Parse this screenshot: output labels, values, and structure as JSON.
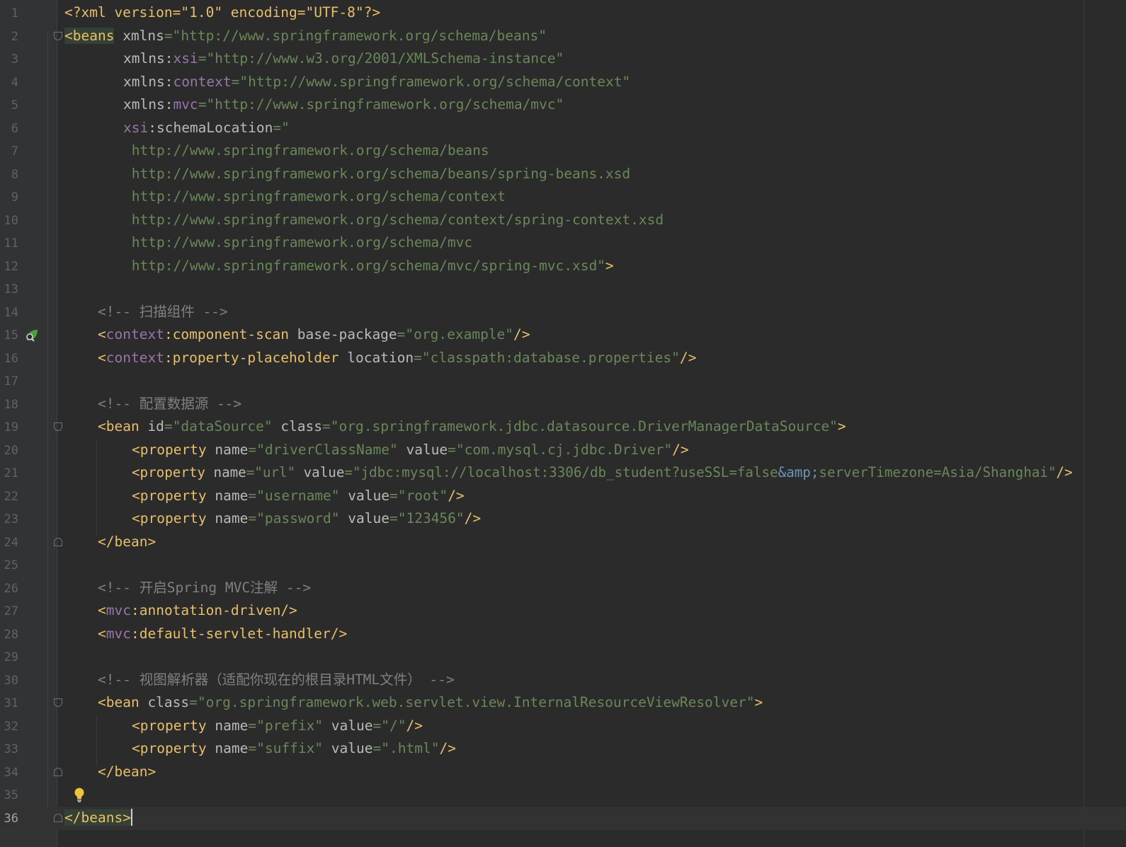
{
  "editor": {
    "line_numbers": [
      "1",
      "2",
      "3",
      "4",
      "5",
      "6",
      "7",
      "8",
      "9",
      "10",
      "11",
      "12",
      "13",
      "14",
      "15",
      "16",
      "17",
      "18",
      "19",
      "20",
      "21",
      "22",
      "23",
      "24",
      "25",
      "26",
      "27",
      "28",
      "29",
      "30",
      "31",
      "32",
      "33",
      "34",
      "35",
      "36"
    ],
    "lines": {
      "l1": [
        "<?xml version=\"1.0\" encoding=\"UTF-8\"?>"
      ],
      "l2": [
        "<beans",
        " xmlns",
        "=",
        "\"http://www.springframework.org/schema/beans\""
      ],
      "l3": [
        "xmlns",
        ":",
        "xsi",
        "=",
        "\"http://www.w3.org/2001/XMLSchema-instance\""
      ],
      "l4": [
        "xmlns",
        ":",
        "context",
        "=",
        "\"http://www.springframework.org/schema/context\""
      ],
      "l5": [
        "xmlns",
        ":",
        "mvc",
        "=",
        "\"http://www.springframework.org/schema/mvc\""
      ],
      "l6": [
        "xsi",
        ":schemaLocation",
        "=",
        "\""
      ],
      "l7": [
        " http://www.springframework.org/schema/beans"
      ],
      "l8": [
        " http://www.springframework.org/schema/beans/spring-beans.xsd"
      ],
      "l9": [
        " http://www.springframework.org/schema/context"
      ],
      "l10": [
        " http://www.springframework.org/schema/context/spring-context.xsd"
      ],
      "l11": [
        " http://www.springframework.org/schema/mvc"
      ],
      "l12": [
        " http://www.springframework.org/schema/mvc/spring-mvc.xsd\"",
        ">"
      ],
      "l14": [
        "<!-- 扫描组件 -->"
      ],
      "l15": [
        "<",
        "context",
        ":component-scan",
        " base-package",
        "=",
        "\"org.example\"",
        "/>"
      ],
      "l16": [
        "<",
        "context",
        ":property-placeholder",
        " location",
        "=",
        "\"classpath:database.properties\"",
        "/>"
      ],
      "l18": [
        "<!-- 配置数据源 -->"
      ],
      "l19": [
        "<bean",
        " id",
        "=",
        "\"dataSource\"",
        " class",
        "=",
        "\"org.springframework.jdbc.datasource.DriverManagerDataSource\"",
        ">"
      ],
      "l20": [
        "<property",
        " name",
        "=",
        "\"driverClassName\"",
        " value",
        "=",
        "\"com.mysql.cj.jdbc.Driver\"",
        "/>"
      ],
      "l21": [
        "<property",
        " name",
        "=",
        "\"url\"",
        " value",
        "=",
        "\"jdbc:mysql://localhost:3306/db_student?useSSL=false",
        "&amp;",
        "serverTimezone=Asia/Shanghai\"",
        "/>"
      ],
      "l22": [
        "<property",
        " name",
        "=",
        "\"username\"",
        " value",
        "=",
        "\"root\"",
        "/>"
      ],
      "l23": [
        "<property",
        " name",
        "=",
        "\"password\"",
        " value",
        "=",
        "\"123456\"",
        "/>"
      ],
      "l24": [
        "</bean>"
      ],
      "l26": [
        "<!-- 开启Spring MVC注解 -->"
      ],
      "l27": [
        "<",
        "mvc",
        ":annotation-driven/>"
      ],
      "l28": [
        "<",
        "mvc",
        ":default-servlet-handler/>"
      ],
      "l30": [
        "<!-- 视图解析器（适配你现在的根目录HTML文件） -->"
      ],
      "l31": [
        "<bean",
        " class",
        "=",
        "\"org.springframework.web.servlet.view.InternalResourceViewResolver\"",
        ">"
      ],
      "l32": [
        "<property",
        " name",
        "=",
        "\"prefix\"",
        " value",
        "=",
        "\"/\"",
        "/>"
      ],
      "l33": [
        "<property",
        " name",
        "=",
        "\"suffix\"",
        " value",
        "=",
        "\".html\"",
        "/>"
      ],
      "l34": [
        "</bean>"
      ],
      "l36": [
        "</beans>"
      ]
    },
    "current_line": 36,
    "colors": {
      "background": "#2b2b2b",
      "tag": "#e8bf6a",
      "attribute": "#bababa",
      "string": "#6a8759",
      "namespace": "#9876aa",
      "comment": "#808080",
      "entity": "#6897bb"
    },
    "icons": {
      "line15": "spring-bean-search-icon",
      "line35": "lightbulb-icon"
    }
  }
}
